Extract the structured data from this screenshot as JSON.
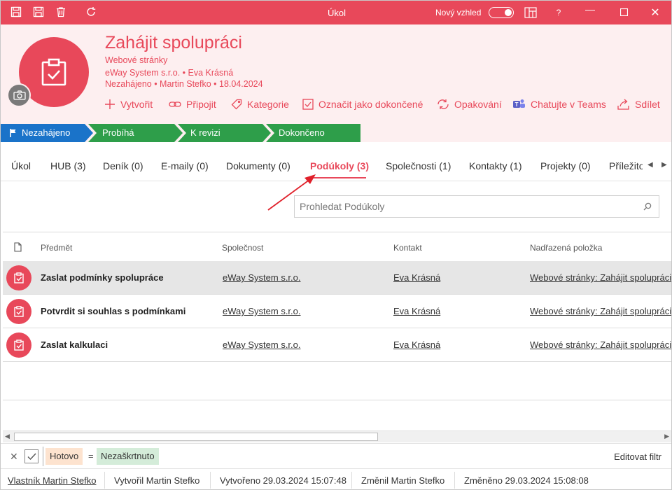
{
  "window": {
    "title": "Úkol",
    "new_look_label": "Nový vzhled"
  },
  "header": {
    "title": "Zahájit spolupráci",
    "project": "Webové stránky",
    "company_contact": "eWay System s.r.o. • Eva Krásná",
    "status_line": "Nezahájeno • Martin Stefko • 18.04.2024"
  },
  "actions": [
    {
      "label": "Vytvořit",
      "icon": "plus-icon"
    },
    {
      "label": "Připojit",
      "icon": "link-icon"
    },
    {
      "label": "Kategorie",
      "icon": "tag-icon"
    },
    {
      "label": "Označit jako dokončené",
      "icon": "checkbox-icon"
    },
    {
      "label": "Opakování",
      "icon": "repeat-icon"
    },
    {
      "label": "Chatujte v Teams",
      "icon": "teams-icon"
    },
    {
      "label": "Sdílet",
      "icon": "share-icon"
    }
  ],
  "stages": [
    {
      "label": "Nezahájeno",
      "color": "#1a73c9",
      "active": true
    },
    {
      "label": "Probíhá",
      "color": "#2e9e4a"
    },
    {
      "label": "K revizi",
      "color": "#2e9e4a"
    },
    {
      "label": "Dokončeno",
      "color": "#2e9e4a"
    }
  ],
  "tabs": [
    {
      "label": "Úkol"
    },
    {
      "label": "HUB (3)"
    },
    {
      "label": "Deník (0)"
    },
    {
      "label": "E-maily (0)"
    },
    {
      "label": "Dokumenty (0)"
    },
    {
      "label": "Podúkoly (3)",
      "active": true
    },
    {
      "label": "Společnosti (1)"
    },
    {
      "label": "Kontakty (1)"
    },
    {
      "label": "Projekty (0)"
    },
    {
      "label": "Příležito"
    }
  ],
  "search": {
    "placeholder": "Prohledat Podúkoly"
  },
  "table": {
    "columns": [
      "Předmět",
      "Společnost",
      "Kontakt",
      "Nadřazená položka"
    ],
    "rows": [
      {
        "subject": "Zaslat podmínky spolupráce",
        "company": "eWay System s.r.o.",
        "contact": "Eva Krásná",
        "parent": "Webové stránky: Zahájit spolupráci",
        "selected": true
      },
      {
        "subject": "Potvrdit si souhlas s podmínkami",
        "company": "eWay System s.r.o.",
        "contact": "Eva Krásná",
        "parent": "Webové stránky: Zahájit spolupráci"
      },
      {
        "subject": "Zaslat kalkulaci",
        "company": "eWay System s.r.o.",
        "contact": "Eva Krásná",
        "parent": "Webové stránky: Zahájit spolupráci"
      }
    ]
  },
  "filter": {
    "field": "Hotovo",
    "operator": "=",
    "value": "Nezaškrtnuto",
    "edit_label": "Editovat filtr"
  },
  "status": {
    "owner": "Vlastník Martin Stefko",
    "created_by": "Vytvořil Martin Stefko",
    "created_at": "Vytvořeno 29.03.2024 15:07:48",
    "modified_by": "Změnil Martin Stefko",
    "modified_at": "Změněno 29.03.2024 15:08:08"
  },
  "colors": {
    "accent": "#e8485a",
    "header_bg": "#fdeff0",
    "stage_active": "#1a73c9",
    "stage_other": "#2e9e4a"
  }
}
